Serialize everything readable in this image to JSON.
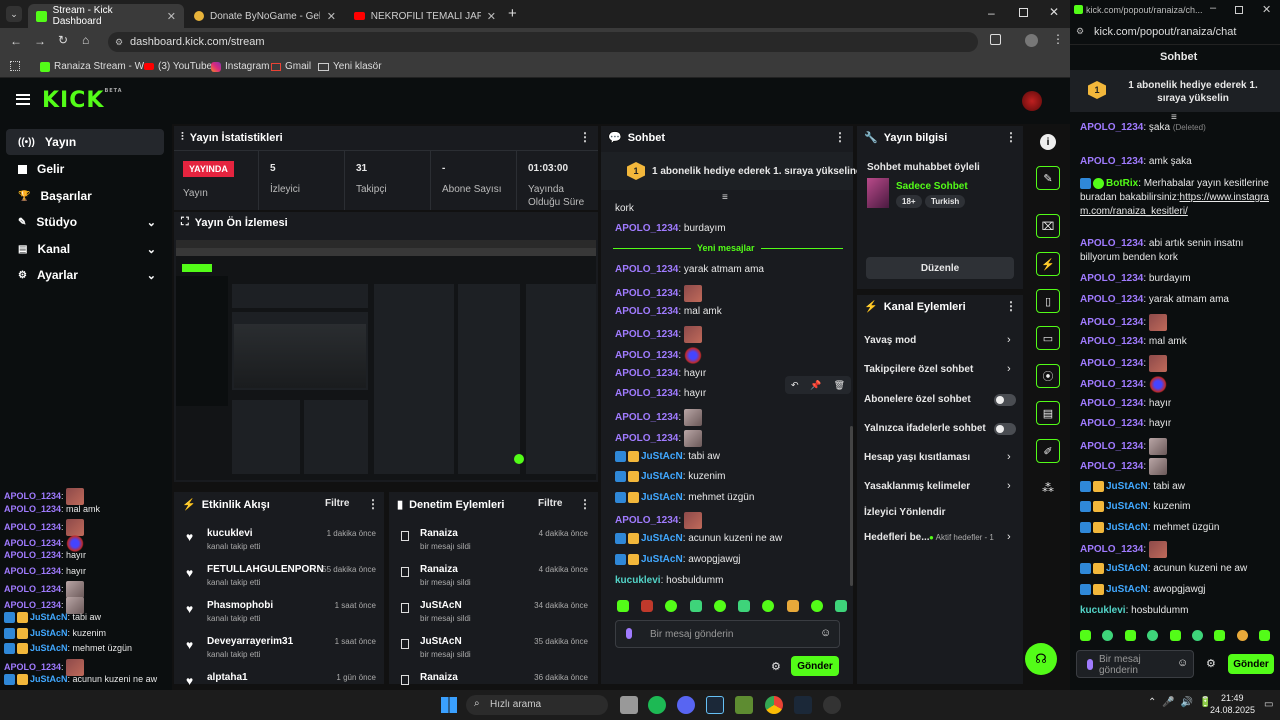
{
  "browser": {
    "tabs": [
      {
        "title": "Stream - Kick Dashboard"
      },
      {
        "title": "Donate ByNoGame - Gelen/Gi..."
      },
      {
        "title": "NEKROFİLİ TEMALI JAPON KOR..."
      }
    ],
    "url": "dashboard.kick.com/stream",
    "bookmarks": [
      "Ranaiza Stream - W...",
      "(3) YouTube",
      "Instagram",
      "Gmail",
      "Yeni klasör"
    ]
  },
  "kick": {
    "logo": "KICK",
    "logo_tag": "BETA",
    "nav": [
      {
        "label": "Yayın"
      },
      {
        "label": "Gelir"
      },
      {
        "label": "Başarılar"
      },
      {
        "label": "Stüdyo"
      },
      {
        "label": "Kanal"
      },
      {
        "label": "Ayarlar"
      }
    ]
  },
  "stats": {
    "title": "Yayın İstatistikleri",
    "live_badge": "YAYINDA",
    "live_label": "Yayın",
    "viewers_value": "5",
    "viewers_label": "İzleyici",
    "followers_value": "31",
    "followers_label": "Takipçi",
    "subs_value": "-",
    "subs_label": "Abone Sayısı",
    "uptime_value": "01:03:00",
    "uptime_label": "Yayında Olduğu Süre"
  },
  "preview": {
    "title": "Yayın Ön İzlemesi"
  },
  "activity": {
    "title": "Etkinlik Akışı",
    "filter": "Filtre",
    "items": [
      {
        "name": "kucuklevi",
        "sub": "kanalı takip etti",
        "time": "1 dakika önce"
      },
      {
        "name": "FETULLAHGULENPORN",
        "sub": "kanalı takip etti",
        "time": "55 dakika önce"
      },
      {
        "name": "Phasmophobi",
        "sub": "kanalı takip etti",
        "time": "1 saat önce"
      },
      {
        "name": "Deveyarrayerim31",
        "sub": "kanalı takip etti",
        "time": "1 saat önce"
      },
      {
        "name": "alptaha1",
        "sub": "",
        "time": "1 gün önce"
      }
    ]
  },
  "moderation": {
    "title": "Denetim Eylemleri",
    "filter": "Filtre",
    "items": [
      {
        "name": "Ranaiza",
        "sub": "bir mesajı sildi",
        "time": "4 dakika önce"
      },
      {
        "name": "Ranaiza",
        "sub": "bir mesajı sildi",
        "time": "4 dakika önce"
      },
      {
        "name": "JuStAcN",
        "sub": "bir mesajı sildi",
        "time": "34 dakika önce"
      },
      {
        "name": "JuStAcN",
        "sub": "bir mesajı sildi",
        "time": "35 dakika önce"
      },
      {
        "name": "Ranaiza",
        "sub": "",
        "time": "36 dakika önce"
      }
    ]
  },
  "chat": {
    "title": "Sohbet",
    "pinned": "1 abonelik hediye ederek 1. sıraya yükseline",
    "new_messages": "Yeni mesajlar",
    "messages": [
      {
        "user": "",
        "text": "kork"
      },
      {
        "user": "APOLO_1234",
        "text": ": burdayım"
      },
      {
        "user": "APOLO_1234",
        "text": ": yarak atmam ama"
      },
      {
        "user": "APOLO_1234",
        "text": ":"
      },
      {
        "user": "APOLO_1234",
        "text": ": mal amk"
      },
      {
        "user": "APOLO_1234",
        "text": ":"
      },
      {
        "user": "APOLO_1234",
        "text": ":"
      },
      {
        "user": "APOLO_1234",
        "text": ": hayır"
      },
      {
        "user": "APOLO_1234",
        "text": ": hayır"
      },
      {
        "user": "APOLO_1234",
        "text": ":"
      },
      {
        "user": "APOLO_1234",
        "text": ":"
      },
      {
        "user": "JuStAcN",
        "text": ": tabi aw"
      },
      {
        "user": "JuStAcN",
        "text": ": kuzenim"
      },
      {
        "user": "JuStAcN",
        "text": ": mehmet üzgün"
      },
      {
        "user": "APOLO_1234",
        "text": ":"
      },
      {
        "user": "JuStAcN",
        "text": ": acunun kuzeni ne aw"
      },
      {
        "user": "JuStAcN",
        "text": ": awopgjawgj"
      },
      {
        "user": "kucuklevi",
        "text": ": hosbuldumm"
      }
    ],
    "input_placeholder": "Bir mesaj gönderin",
    "send": "Gönder"
  },
  "stream_info": {
    "title": "Yayın bilgisi",
    "stream_title": "Sohbet muhabbet öyleli",
    "category": "Sadece Sohbet",
    "tags": [
      "18+",
      "Turkish"
    ],
    "edit": "Düzenle"
  },
  "channel_actions": {
    "title": "Kanal Eylemleri",
    "items": [
      {
        "label": "Yavaş mod"
      },
      {
        "label": "Takipçilere özel sohbet"
      },
      {
        "label": "Abonelere özel sohbet"
      },
      {
        "label": "Yalnızca ifadelerle sohbet"
      },
      {
        "label": "Hesap yaşı kısıtlaması"
      },
      {
        "label": "Yasaklanmış kelimeler"
      },
      {
        "label": "İzleyici Yönlendir"
      },
      {
        "label": "Hedefleri be..."
      }
    ],
    "goals_status": "Aktif hedefler - 1"
  },
  "overlay_chat": [
    {
      "user": "APOLO_1234",
      "text": ":"
    },
    {
      "user": "APOLO_1234",
      "text": ": mal amk"
    },
    {
      "user": "APOLO_1234",
      "text": ":"
    },
    {
      "user": "APOLO_1234",
      "text": ":"
    },
    {
      "user": "APOLO_1234",
      "text": ": hayır"
    },
    {
      "user": "APOLO_1234",
      "text": ": hayır"
    },
    {
      "user": "APOLO_1234",
      "text": ":"
    },
    {
      "user": "APOLO_1234",
      "text": ":"
    },
    {
      "user": "JuStAcN",
      "text": ": tabi aw"
    },
    {
      "user": "JuStAcN",
      "text": ": kuzenim"
    },
    {
      "user": "JuStAcN",
      "text": ": mehmet üzgün"
    },
    {
      "user": "APOLO_1234",
      "text": ":"
    },
    {
      "user": "JuStAcN",
      "text": ": acunun kuzeni ne aw"
    },
    {
      "user": "JuStAcN",
      "text": ": awopgjawgj"
    },
    {
      "user": "kucuklevi",
      "text": ": hosbuldumm"
    }
  ],
  "popout": {
    "url_small": "kick.com/popout/ranaiza/ch...",
    "url": "kick.com/popout/ranaiza/chat",
    "title": "Sohbet",
    "pinned": "1 abonelik hediye ederek 1. sıraya yükselin",
    "messages": [
      {
        "user": "APOLO_1234",
        "text": ": şaka",
        "note": "(Deleted)"
      },
      {
        "user": "APOLO_1234",
        "text": ": amk şaka"
      },
      {
        "user": "BotRix",
        "text": ": Merhabalar yayın kesitlerine buradan bakabilirsiniz:",
        "link": "https://www.instagram.com/ranaiza_kesitleri/"
      },
      {
        "user": "APOLO_1234",
        "text": ": abi artık senin insatnı billyorum benden kork"
      },
      {
        "user": "APOLO_1234",
        "text": ": burdayım"
      },
      {
        "user": "APOLO_1234",
        "text": ": yarak atmam ama"
      },
      {
        "user": "APOLO_1234",
        "text": ":"
      },
      {
        "user": "APOLO_1234",
        "text": ": mal amk"
      },
      {
        "user": "APOLO_1234",
        "text": ":"
      },
      {
        "user": "APOLO_1234",
        "text": ":"
      },
      {
        "user": "APOLO_1234",
        "text": ": hayır"
      },
      {
        "user": "APOLO_1234",
        "text": ": hayır"
      },
      {
        "user": "APOLO_1234",
        "text": ":"
      },
      {
        "user": "APOLO_1234",
        "text": ":"
      },
      {
        "user": "JuStAcN",
        "text": ": tabi aw"
      },
      {
        "user": "JuStAcN",
        "text": ": kuzenim"
      },
      {
        "user": "JuStAcN",
        "text": ": mehmet üzgün"
      },
      {
        "user": "APOLO_1234",
        "text": ":"
      },
      {
        "user": "JuStAcN",
        "text": ": acunun kuzeni ne aw"
      },
      {
        "user": "JuStAcN",
        "text": ": awopgjawgj"
      },
      {
        "user": "kucuklevi",
        "text": ": hosbuldumm"
      }
    ],
    "input_placeholder": "Bir mesaj gönderin",
    "send": "Gönder"
  },
  "taskbar": {
    "search": "Hızlı arama",
    "time": "21:49",
    "date": "24.08.2025"
  },
  "colors": {
    "accent": "#53fc18",
    "live": "#e5243f",
    "bg": "#0b0e0f",
    "panel": "#191b1f"
  }
}
